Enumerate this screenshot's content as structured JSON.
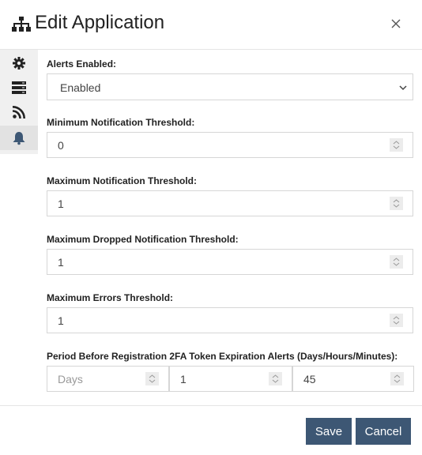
{
  "header": {
    "title": "Edit Application",
    "title_icon": "sitemap-icon",
    "close_icon": "close-icon"
  },
  "sidebar": {
    "items": [
      {
        "icon": "gear-icon",
        "active": false
      },
      {
        "icon": "server-icon",
        "active": false
      },
      {
        "icon": "rss-icon",
        "active": false
      },
      {
        "icon": "bell-icon",
        "active": true
      }
    ]
  },
  "form": {
    "alerts_enabled": {
      "label": "Alerts Enabled:",
      "value": "Enabled"
    },
    "min_notification": {
      "label": "Minimum Notification Threshold:",
      "value": "0"
    },
    "max_notification": {
      "label": "Maximum Notification Threshold:",
      "value": "1"
    },
    "max_dropped": {
      "label": "Maximum Dropped Notification Threshold:",
      "value": "1"
    },
    "max_errors": {
      "label": "Maximum Errors Threshold:",
      "value": "1"
    },
    "token_expiration": {
      "label": "Period Before Registration 2FA Token Expiration Alerts (Days/Hours/Minutes):",
      "days_placeholder": "Days",
      "hours_value": "1",
      "minutes_value": "45"
    }
  },
  "footer": {
    "save_label": "Save",
    "cancel_label": "Cancel"
  },
  "colors": {
    "button_bg": "#3d5774",
    "active_icon": "#3d5774"
  }
}
